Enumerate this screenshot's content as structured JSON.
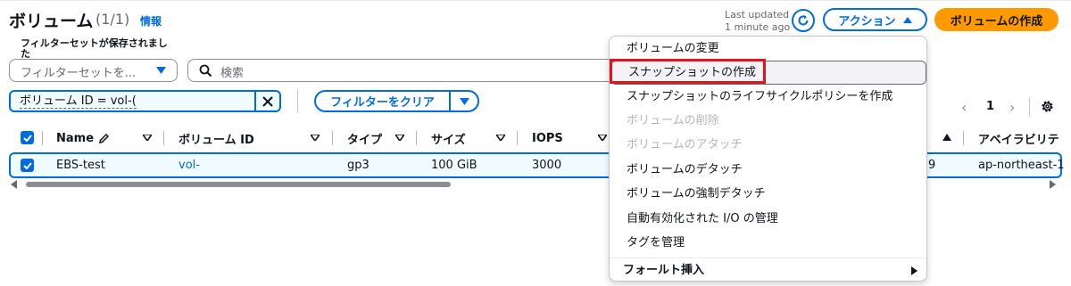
{
  "header": {
    "title": "ボリューム",
    "count": "(1/1)",
    "info": "情報",
    "last_updated_line1": "Last updated",
    "last_updated_line2": "1 minute ago",
    "actions_label": "アクション",
    "create_label": "ボリュームの作成"
  },
  "filters": {
    "saved_label": "フィルターセットが保存されました",
    "saved_placeholder": "フィルターセットを...",
    "search_placeholder": "検索",
    "token_text": "ボリューム ID = vol-(",
    "clear_label": "フィルターをクリア"
  },
  "pagination": {
    "prev": "‹",
    "page": "1",
    "next": "›"
  },
  "table": {
    "columns": [
      "Name",
      "ボリューム ID",
      "タイプ",
      "サイズ",
      "IOPS",
      "アベイラビリテ"
    ],
    "row": {
      "name": "EBS-test",
      "volume_id": "vol-",
      "type": "gp3",
      "size": "100 GiB",
      "iops": "3000",
      "hidden_tail": "9",
      "az": "ap-northeast-1"
    }
  },
  "menu": {
    "items": [
      {
        "label": "ボリュームの変更",
        "disabled": false
      },
      {
        "label": "スナップショットの作成",
        "disabled": false,
        "highlighted": true
      },
      {
        "label": "スナップショットのライフサイクルポリシーを作成",
        "disabled": false
      },
      {
        "label": "ボリュームの削除",
        "disabled": true
      },
      {
        "label": "ボリュームのアタッチ",
        "disabled": true
      },
      {
        "label": "ボリュームのデタッチ",
        "disabled": false
      },
      {
        "label": "ボリュームの強制デタッチ",
        "disabled": false
      },
      {
        "label": "自動有効化された I/O の管理",
        "disabled": false
      },
      {
        "label": "タグを管理",
        "disabled": false
      }
    ],
    "submenu_label": "フォールト挿入"
  },
  "colors": {
    "primary": "#006ce0",
    "create_button": "#ff9900",
    "highlight_box": "#e0141f"
  }
}
